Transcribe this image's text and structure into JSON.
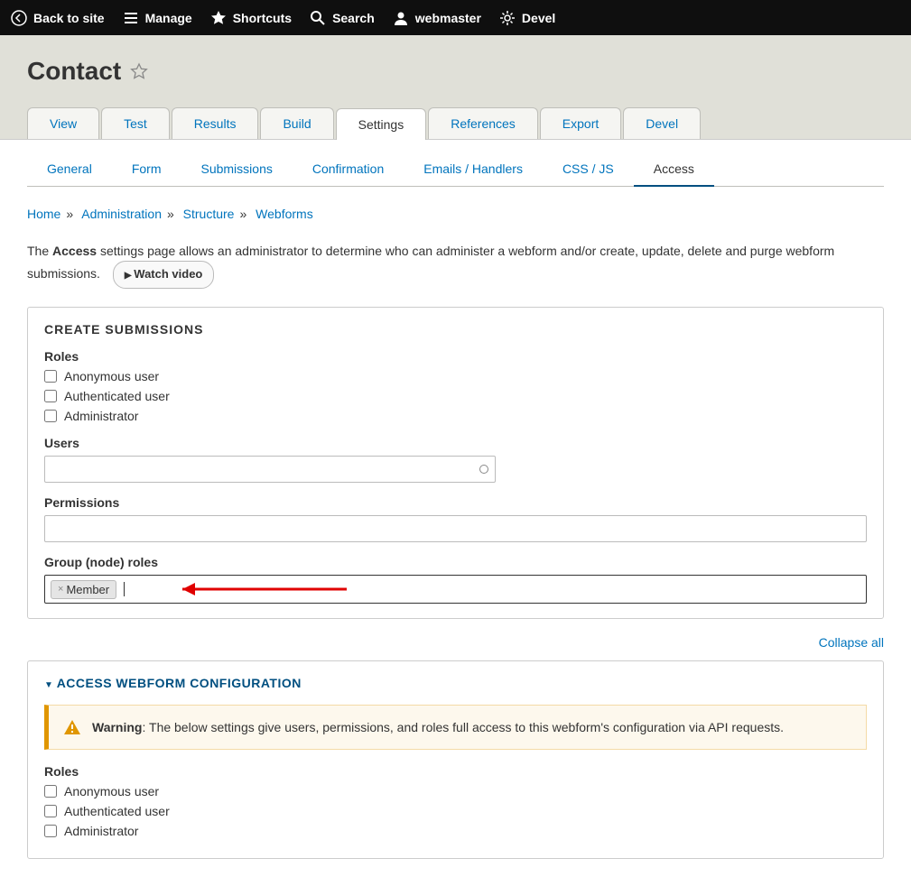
{
  "toolbar": {
    "back": "Back to site",
    "manage": "Manage",
    "shortcuts": "Shortcuts",
    "search": "Search",
    "user": "webmaster",
    "devel": "Devel"
  },
  "page_title": "Contact",
  "primary_tabs": {
    "view": "View",
    "test": "Test",
    "results": "Results",
    "build": "Build",
    "settings": "Settings",
    "references": "References",
    "export": "Export",
    "devel": "Devel"
  },
  "secondary_tabs": {
    "general": "General",
    "form": "Form",
    "submissions": "Submissions",
    "confirmation": "Confirmation",
    "emails": "Emails / Handlers",
    "css": "CSS / JS",
    "access": "Access"
  },
  "breadcrumb": {
    "home": "Home",
    "admin": "Administration",
    "structure": "Structure",
    "webforms": "Webforms"
  },
  "intro": {
    "text_before": "The ",
    "strong": "Access",
    "text_after": " settings page allows an administrator to determine who can administer a webform and/or create, update, delete and purge webform submissions.",
    "watch": "Watch video"
  },
  "section1": {
    "title": "CREATE SUBMISSIONS",
    "roles_label": "Roles",
    "role1": "Anonymous user",
    "role2": "Authenticated user",
    "role3": "Administrator",
    "users_label": "Users",
    "permissions_label": "Permissions",
    "group_roles_label": "Group (node) roles",
    "tag": "Member"
  },
  "collapse": "Collapse all",
  "section2": {
    "title": "ACCESS WEBFORM CONFIGURATION",
    "warning_strong": "Warning",
    "warning_text": ": The below settings give users, permissions, and roles full access to this webform's configuration via API requests.",
    "roles_label": "Roles",
    "role1": "Anonymous user",
    "role2": "Authenticated user",
    "role3": "Administrator"
  }
}
